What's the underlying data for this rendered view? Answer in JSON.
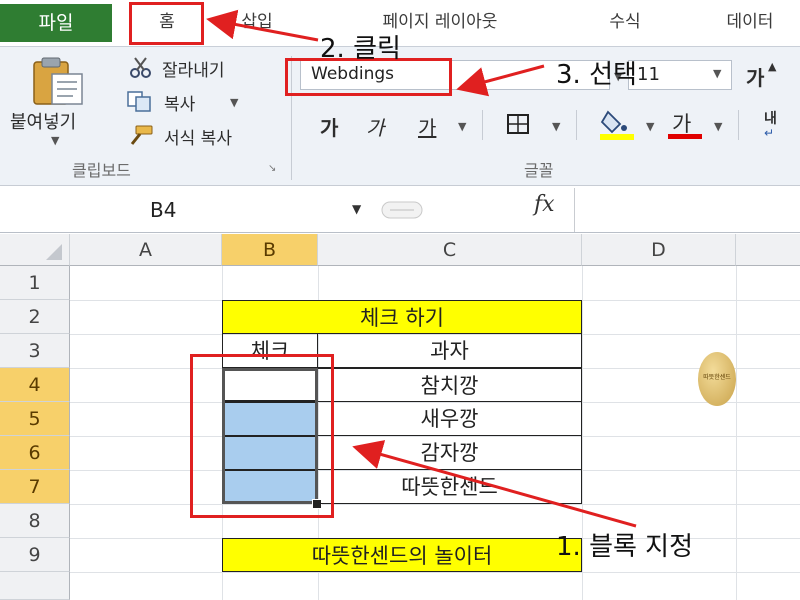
{
  "ribbon": {
    "tabs": [
      "파일",
      "홈",
      "삽입",
      "페이지 레이아웃",
      "수식",
      "데이터"
    ],
    "clipboard": {
      "paste_label": "붙여넣기",
      "cut_label": "잘라내기",
      "copy_label": "복사",
      "format_painter_label": "서식 복사",
      "group_label": "클립보드"
    },
    "font": {
      "font_name": "Webdings",
      "font_size": "11",
      "grow_glyph": "가",
      "bold_glyph": "가",
      "italic_glyph": "가",
      "underline_glyph": "가",
      "font_color_glyph": "가",
      "wrap_glyph": "내",
      "group_label": "글꼴"
    }
  },
  "formula_bar": {
    "name_box": "B4",
    "fx_label": "fx",
    "value": ""
  },
  "grid": {
    "columns": [
      "A",
      "B",
      "C",
      "D"
    ],
    "rows": [
      "1",
      "2",
      "3",
      "4",
      "5",
      "6",
      "7",
      "8",
      "9"
    ],
    "cells": {
      "C2": "체크 하기",
      "B3": "체크",
      "C3": "과자",
      "C4": "참치깡",
      "C5": "새우깡",
      "C6": "감자깡",
      "C7": "따뜻한센드",
      "BC9": "따뜻한센드의 놀이터"
    },
    "stamp_text": "따뜻한센드"
  },
  "annotations": {
    "step1": "1. 블록 지정",
    "step2": "2. 클릭",
    "step3": "3. 선택"
  },
  "colors": {
    "file_tab": "#2f7d32",
    "header_yellow": "#ffff00",
    "selection_blue": "#a9cdee",
    "annotation_red": "#e02020",
    "selected_header": "#f7d06a"
  }
}
